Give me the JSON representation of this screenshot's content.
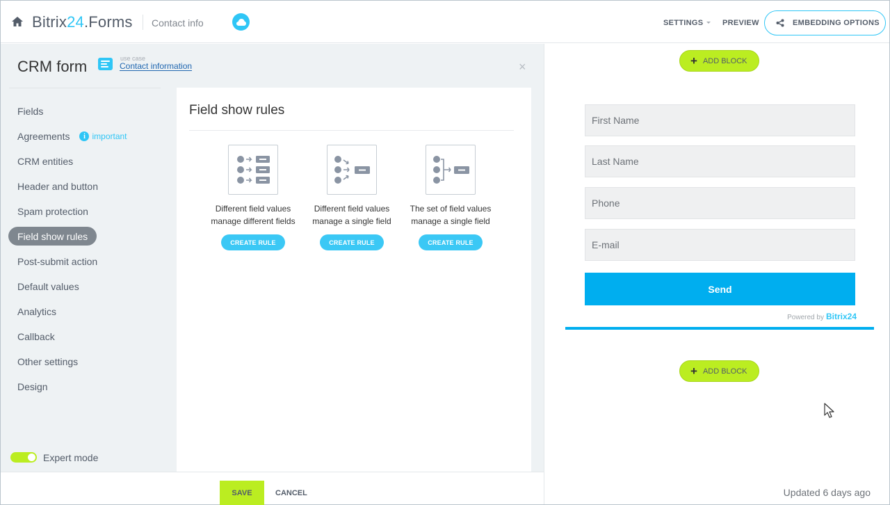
{
  "header": {
    "logo_prefix": "Bitrix",
    "logo_num": "24",
    "logo_suffix": ".Forms",
    "breadcrumb": "Contact info",
    "settings_label": "SETTINGS",
    "preview_label": "PREVIEW",
    "embedding_label": "EMBEDDING OPTIONS",
    "icons": [
      "home-icon",
      "cloud-icon",
      "chevron-down-icon",
      "share-icon"
    ]
  },
  "panel": {
    "title": "CRM form",
    "use_case_label": "use case",
    "use_case_link": "Contact information",
    "close_glyph": "×"
  },
  "nav": {
    "items": [
      {
        "label": "Fields"
      },
      {
        "label": "Agreements",
        "badge": "important"
      },
      {
        "label": "CRM entities"
      },
      {
        "label": "Header and button"
      },
      {
        "label": "Spam protection"
      },
      {
        "label": "Field show rules",
        "active": true
      },
      {
        "label": "Post-submit action"
      },
      {
        "label": "Default values"
      },
      {
        "label": "Analytics"
      },
      {
        "label": "Callback"
      },
      {
        "label": "Other settings"
      },
      {
        "label": "Design"
      }
    ],
    "info_glyph": "i"
  },
  "expert_mode": {
    "label": "Expert mode",
    "enabled": true
  },
  "content": {
    "title": "Field show rules",
    "rules": [
      {
        "line1": "Different field values",
        "line2": "manage different fields",
        "button": "CREATE RULE"
      },
      {
        "line1": "Different field values",
        "line2": "manage a single field",
        "button": "CREATE RULE"
      },
      {
        "line1": "The set of field values",
        "line2": "manage a single field",
        "button": "CREATE RULE"
      }
    ]
  },
  "footer": {
    "save_label": "SAVE",
    "cancel_label": "CANCEL"
  },
  "preview": {
    "add_block_label": "ADD BLOCK",
    "plus_glyph": "+",
    "fields": [
      "First Name",
      "Last Name",
      "Phone",
      "E-mail"
    ],
    "send_label": "Send",
    "powered_label": "Powered by",
    "powered_brand": "Bitrix",
    "powered_num": "24",
    "updated": "Updated 6 days ago"
  },
  "colors": {
    "accent": "#2fc6f6",
    "send": "#00aeef",
    "lime": "#bbed21",
    "panel_bg": "#eef2f4",
    "nav_active": "#7f878f"
  }
}
